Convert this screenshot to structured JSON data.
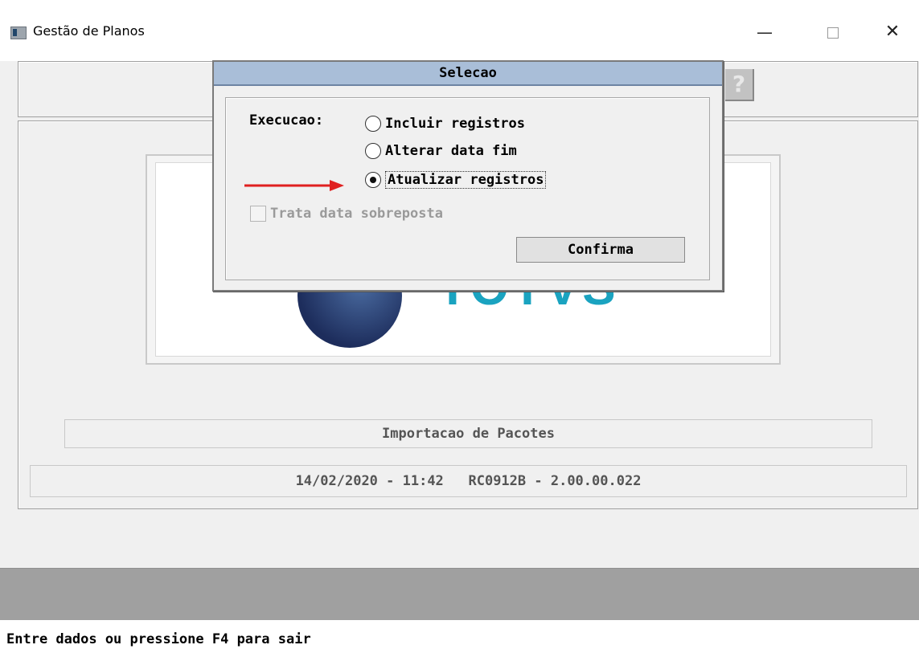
{
  "window": {
    "title": "Gestão de Planos",
    "minimize_glyph": "—",
    "close_glyph": "✕"
  },
  "toolbar": {
    "help_icon": "question-mark-icon",
    "help_glyph": "?"
  },
  "main": {
    "logo_text": "TOTVS",
    "import_label": "Importacao de Pacotes",
    "version_label": "14/02/2020 - 11:42   RC0912B - 2.00.00.022"
  },
  "dialog": {
    "title": "Selecao",
    "exec_label": "Execucao:",
    "options": [
      {
        "label": "Incluir registros",
        "checked": false
      },
      {
        "label": "Alterar data fim",
        "checked": false
      },
      {
        "label": "Atualizar registros",
        "checked": true
      }
    ],
    "checkbox": {
      "label": "Trata data sobreposta",
      "checked": false,
      "disabled": true
    },
    "confirm_label": "Confirma"
  },
  "annotation": {
    "arrow_color": "#e02020"
  },
  "status": {
    "text": "Entre dados ou pressione F4 para sair"
  }
}
